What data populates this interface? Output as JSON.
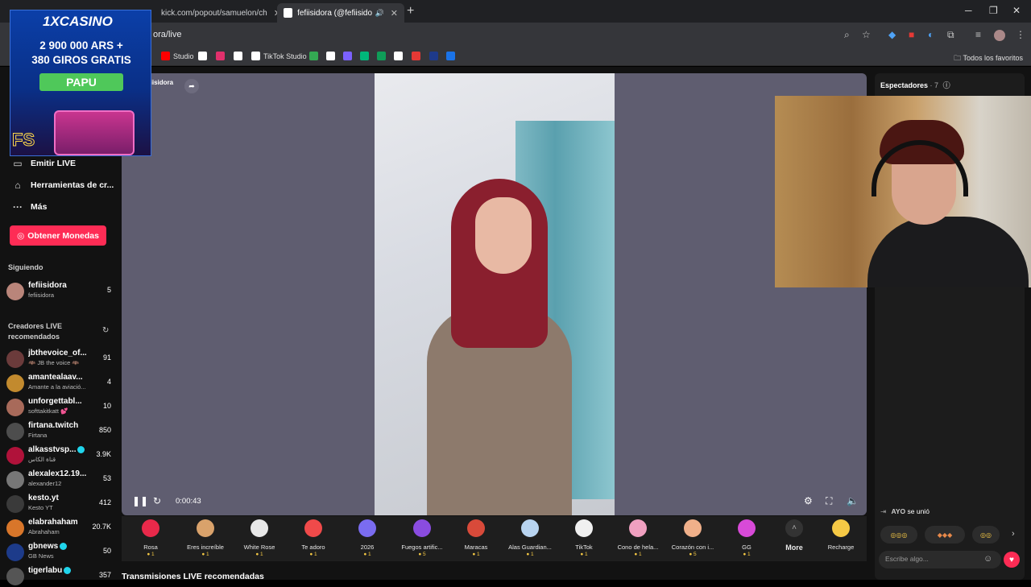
{
  "browser": {
    "tabs": [
      {
        "title": "kick.com/popout/samuelon/ch",
        "favicon_color": "#53fc18"
      },
      {
        "title": "fefiisidora (@fefiisidora) es",
        "favicon_color": "#ffffff"
      }
    ],
    "url": "ora/live",
    "bookmarks": [
      {
        "label": "Studio",
        "color": "#ff0000"
      },
      {
        "label": "",
        "color": "#ffffff"
      },
      {
        "label": "",
        "color": "#e1306c"
      },
      {
        "label": "",
        "color": "#ffffff"
      },
      {
        "label": "TikTok Studio",
        "color": "#ffffff"
      },
      {
        "label": "",
        "color": "#34a853"
      },
      {
        "label": "",
        "color": "#ffffff"
      },
      {
        "label": "",
        "color": "#7b61ff"
      },
      {
        "label": "",
        "color": "#00b67a"
      },
      {
        "label": "",
        "color": "#0f9d58"
      },
      {
        "label": "",
        "color": "#ffffff"
      },
      {
        "label": "",
        "color": "#e53935"
      },
      {
        "label": "",
        "color": "#1e3a8a"
      },
      {
        "label": "",
        "color": "#1a73e8"
      }
    ],
    "all_bookmarks": "Todos los favoritos"
  },
  "ad": {
    "brand": "1XCASINO",
    "line1": "2 900 000 ARS +",
    "line2": "380 GIROS GRATIS",
    "button": "PAPU",
    "badge": "FS"
  },
  "sidebar": {
    "nav": [
      {
        "label": "Emitir LIVE",
        "icon": "camera-icon"
      },
      {
        "label": "Herramientas de cr...",
        "icon": "home-icon"
      },
      {
        "label": "Más",
        "icon": "more-icon"
      }
    ],
    "coins_button": "Obtener Monedas",
    "following_title": "Siguiendo",
    "following": [
      {
        "name": "fefiisidora",
        "sub": "fefiisidora",
        "count": "5",
        "color": "#b9857a"
      }
    ],
    "recommended_title": "Creadores LIVE recomendados",
    "creators": [
      {
        "name": "jbthevoice_of...",
        "sub": "🦇 JB the voice 🦇",
        "count": "91",
        "color": "#6b3b3b"
      },
      {
        "name": "amantealaav...",
        "sub": "Amante a la aviació...",
        "count": "4",
        "color": "#c28a2e"
      },
      {
        "name": "unforgettabl...",
        "sub": "softtakitkatt 💕",
        "count": "10",
        "color": "#a86a5a"
      },
      {
        "name": "firtana.twitch",
        "sub": "Firtana",
        "count": "850",
        "color": "#4d4d4d"
      },
      {
        "name": "alkasstvsp...",
        "sub": "قناة الكاس",
        "count": "3.9K",
        "color": "#b0123a",
        "verified": true
      },
      {
        "name": "alexalex12.19...",
        "sub": "alexander12",
        "count": "53",
        "color": "#777777"
      },
      {
        "name": "kesto.yt",
        "sub": "Kesto YT",
        "count": "412",
        "color": "#3a3a3a"
      },
      {
        "name": "elabrahaham",
        "sub": "Abrahaham",
        "count": "20.7K",
        "color": "#d8762a"
      },
      {
        "name": "gbnews",
        "sub": "GB News",
        "count": "50",
        "color": "#1d3b8a",
        "verified": true
      },
      {
        "name": "tigerlabu",
        "sub": "",
        "count": "357",
        "color": "#555555",
        "verified": true
      }
    ]
  },
  "stage": {
    "streamer": "fiisidora",
    "time": "0:00:43"
  },
  "gifts": [
    {
      "label": "Rosa",
      "price": "1",
      "color": "#e8294a"
    },
    {
      "label": "Eres increíble",
      "price": "1",
      "color": "#d9a26b"
    },
    {
      "label": "White Rose",
      "price": "1",
      "color": "#e8e8e8"
    },
    {
      "label": "Te adoro",
      "price": "1",
      "color": "#f04a4a"
    },
    {
      "label": "2026",
      "price": "1",
      "color": "#7a6cf0"
    },
    {
      "label": "Fuegos artific...",
      "price": "5",
      "color": "#8a4ce0"
    },
    {
      "label": "Maracas",
      "price": "1",
      "color": "#d84a3a"
    },
    {
      "label": "Alas Guardian...",
      "price": "1",
      "color": "#b8d4f0"
    },
    {
      "label": "TikTok",
      "price": "1",
      "color": "#f0f0f0"
    },
    {
      "label": "Cono de hela...",
      "price": "1",
      "color": "#f0a0c0"
    },
    {
      "label": "Corazón con i...",
      "price": "5",
      "color": "#f0b08a"
    },
    {
      "label": "GG",
      "price": "1",
      "color": "#d84ad8"
    }
  ],
  "gift_more": "More",
  "recharge": "Recharge",
  "recommended_section": "Transmisiones LIVE recomendadas",
  "right_panel": {
    "viewers_label": "Espectadores",
    "viewers_count": "· 7",
    "join_user": "AYO",
    "join_text": "se unió",
    "chat_placeholder": "Escribe algo..."
  }
}
